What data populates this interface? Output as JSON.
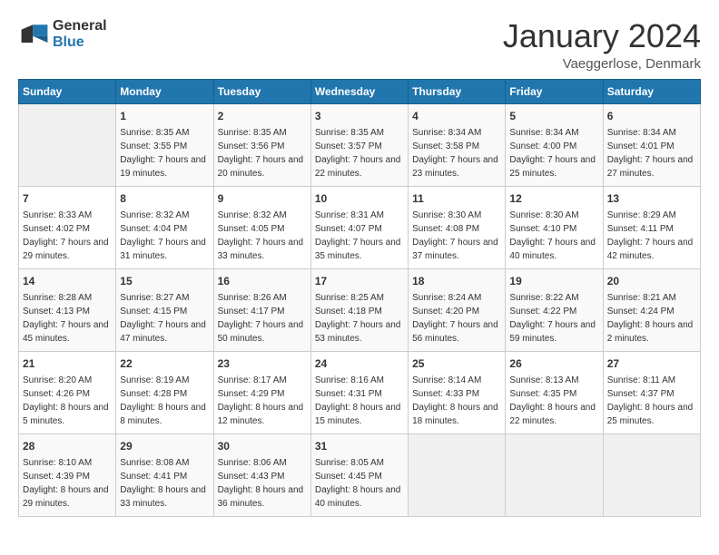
{
  "header": {
    "logo_general": "General",
    "logo_blue": "Blue",
    "month_title": "January 2024",
    "location": "Vaeggerlose, Denmark"
  },
  "days_of_week": [
    "Sunday",
    "Monday",
    "Tuesday",
    "Wednesday",
    "Thursday",
    "Friday",
    "Saturday"
  ],
  "weeks": [
    [
      {
        "day": "",
        "sunrise": "",
        "sunset": "",
        "daylight": "",
        "empty": true
      },
      {
        "day": "1",
        "sunrise": "Sunrise: 8:35 AM",
        "sunset": "Sunset: 3:55 PM",
        "daylight": "Daylight: 7 hours and 19 minutes."
      },
      {
        "day": "2",
        "sunrise": "Sunrise: 8:35 AM",
        "sunset": "Sunset: 3:56 PM",
        "daylight": "Daylight: 7 hours and 20 minutes."
      },
      {
        "day": "3",
        "sunrise": "Sunrise: 8:35 AM",
        "sunset": "Sunset: 3:57 PM",
        "daylight": "Daylight: 7 hours and 22 minutes."
      },
      {
        "day": "4",
        "sunrise": "Sunrise: 8:34 AM",
        "sunset": "Sunset: 3:58 PM",
        "daylight": "Daylight: 7 hours and 23 minutes."
      },
      {
        "day": "5",
        "sunrise": "Sunrise: 8:34 AM",
        "sunset": "Sunset: 4:00 PM",
        "daylight": "Daylight: 7 hours and 25 minutes."
      },
      {
        "day": "6",
        "sunrise": "Sunrise: 8:34 AM",
        "sunset": "Sunset: 4:01 PM",
        "daylight": "Daylight: 7 hours and 27 minutes."
      }
    ],
    [
      {
        "day": "7",
        "sunrise": "Sunrise: 8:33 AM",
        "sunset": "Sunset: 4:02 PM",
        "daylight": "Daylight: 7 hours and 29 minutes."
      },
      {
        "day": "8",
        "sunrise": "Sunrise: 8:32 AM",
        "sunset": "Sunset: 4:04 PM",
        "daylight": "Daylight: 7 hours and 31 minutes."
      },
      {
        "day": "9",
        "sunrise": "Sunrise: 8:32 AM",
        "sunset": "Sunset: 4:05 PM",
        "daylight": "Daylight: 7 hours and 33 minutes."
      },
      {
        "day": "10",
        "sunrise": "Sunrise: 8:31 AM",
        "sunset": "Sunset: 4:07 PM",
        "daylight": "Daylight: 7 hours and 35 minutes."
      },
      {
        "day": "11",
        "sunrise": "Sunrise: 8:30 AM",
        "sunset": "Sunset: 4:08 PM",
        "daylight": "Daylight: 7 hours and 37 minutes."
      },
      {
        "day": "12",
        "sunrise": "Sunrise: 8:30 AM",
        "sunset": "Sunset: 4:10 PM",
        "daylight": "Daylight: 7 hours and 40 minutes."
      },
      {
        "day": "13",
        "sunrise": "Sunrise: 8:29 AM",
        "sunset": "Sunset: 4:11 PM",
        "daylight": "Daylight: 7 hours and 42 minutes."
      }
    ],
    [
      {
        "day": "14",
        "sunrise": "Sunrise: 8:28 AM",
        "sunset": "Sunset: 4:13 PM",
        "daylight": "Daylight: 7 hours and 45 minutes."
      },
      {
        "day": "15",
        "sunrise": "Sunrise: 8:27 AM",
        "sunset": "Sunset: 4:15 PM",
        "daylight": "Daylight: 7 hours and 47 minutes."
      },
      {
        "day": "16",
        "sunrise": "Sunrise: 8:26 AM",
        "sunset": "Sunset: 4:17 PM",
        "daylight": "Daylight: 7 hours and 50 minutes."
      },
      {
        "day": "17",
        "sunrise": "Sunrise: 8:25 AM",
        "sunset": "Sunset: 4:18 PM",
        "daylight": "Daylight: 7 hours and 53 minutes."
      },
      {
        "day": "18",
        "sunrise": "Sunrise: 8:24 AM",
        "sunset": "Sunset: 4:20 PM",
        "daylight": "Daylight: 7 hours and 56 minutes."
      },
      {
        "day": "19",
        "sunrise": "Sunrise: 8:22 AM",
        "sunset": "Sunset: 4:22 PM",
        "daylight": "Daylight: 7 hours and 59 minutes."
      },
      {
        "day": "20",
        "sunrise": "Sunrise: 8:21 AM",
        "sunset": "Sunset: 4:24 PM",
        "daylight": "Daylight: 8 hours and 2 minutes."
      }
    ],
    [
      {
        "day": "21",
        "sunrise": "Sunrise: 8:20 AM",
        "sunset": "Sunset: 4:26 PM",
        "daylight": "Daylight: 8 hours and 5 minutes."
      },
      {
        "day": "22",
        "sunrise": "Sunrise: 8:19 AM",
        "sunset": "Sunset: 4:28 PM",
        "daylight": "Daylight: 8 hours and 8 minutes."
      },
      {
        "day": "23",
        "sunrise": "Sunrise: 8:17 AM",
        "sunset": "Sunset: 4:29 PM",
        "daylight": "Daylight: 8 hours and 12 minutes."
      },
      {
        "day": "24",
        "sunrise": "Sunrise: 8:16 AM",
        "sunset": "Sunset: 4:31 PM",
        "daylight": "Daylight: 8 hours and 15 minutes."
      },
      {
        "day": "25",
        "sunrise": "Sunrise: 8:14 AM",
        "sunset": "Sunset: 4:33 PM",
        "daylight": "Daylight: 8 hours and 18 minutes."
      },
      {
        "day": "26",
        "sunrise": "Sunrise: 8:13 AM",
        "sunset": "Sunset: 4:35 PM",
        "daylight": "Daylight: 8 hours and 22 minutes."
      },
      {
        "day": "27",
        "sunrise": "Sunrise: 8:11 AM",
        "sunset": "Sunset: 4:37 PM",
        "daylight": "Daylight: 8 hours and 25 minutes."
      }
    ],
    [
      {
        "day": "28",
        "sunrise": "Sunrise: 8:10 AM",
        "sunset": "Sunset: 4:39 PM",
        "daylight": "Daylight: 8 hours and 29 minutes."
      },
      {
        "day": "29",
        "sunrise": "Sunrise: 8:08 AM",
        "sunset": "Sunset: 4:41 PM",
        "daylight": "Daylight: 8 hours and 33 minutes."
      },
      {
        "day": "30",
        "sunrise": "Sunrise: 8:06 AM",
        "sunset": "Sunset: 4:43 PM",
        "daylight": "Daylight: 8 hours and 36 minutes."
      },
      {
        "day": "31",
        "sunrise": "Sunrise: 8:05 AM",
        "sunset": "Sunset: 4:45 PM",
        "daylight": "Daylight: 8 hours and 40 minutes."
      },
      {
        "day": "",
        "sunrise": "",
        "sunset": "",
        "daylight": "",
        "empty": true
      },
      {
        "day": "",
        "sunrise": "",
        "sunset": "",
        "daylight": "",
        "empty": true
      },
      {
        "day": "",
        "sunrise": "",
        "sunset": "",
        "daylight": "",
        "empty": true
      }
    ]
  ]
}
